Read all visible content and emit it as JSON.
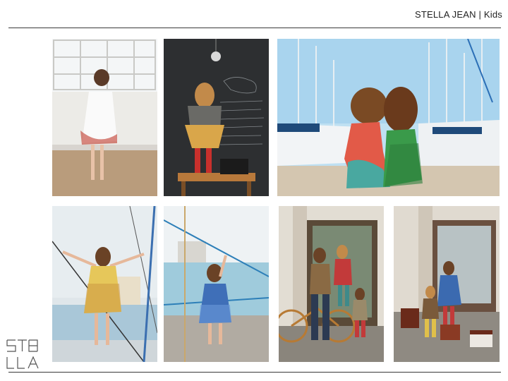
{
  "header": {
    "title": "STELLA JEAN | Kids"
  },
  "logo": {
    "text_line1": "STE",
    "text_line2": "LLA",
    "color": "#555555"
  },
  "photos": [
    {
      "name": "girl-white-dress-window"
    },
    {
      "name": "girl-chalkboard-sewing-machine"
    },
    {
      "name": "two-girls-harbor"
    },
    {
      "name": "girl-yellow-dress-rigging"
    },
    {
      "name": "girl-blue-dress-pier"
    },
    {
      "name": "man-bike-kids-barbershop"
    },
    {
      "name": "kids-barbershop-suitcases"
    }
  ],
  "colors": {
    "rule": "#3a3a3a",
    "text": "#222222"
  }
}
